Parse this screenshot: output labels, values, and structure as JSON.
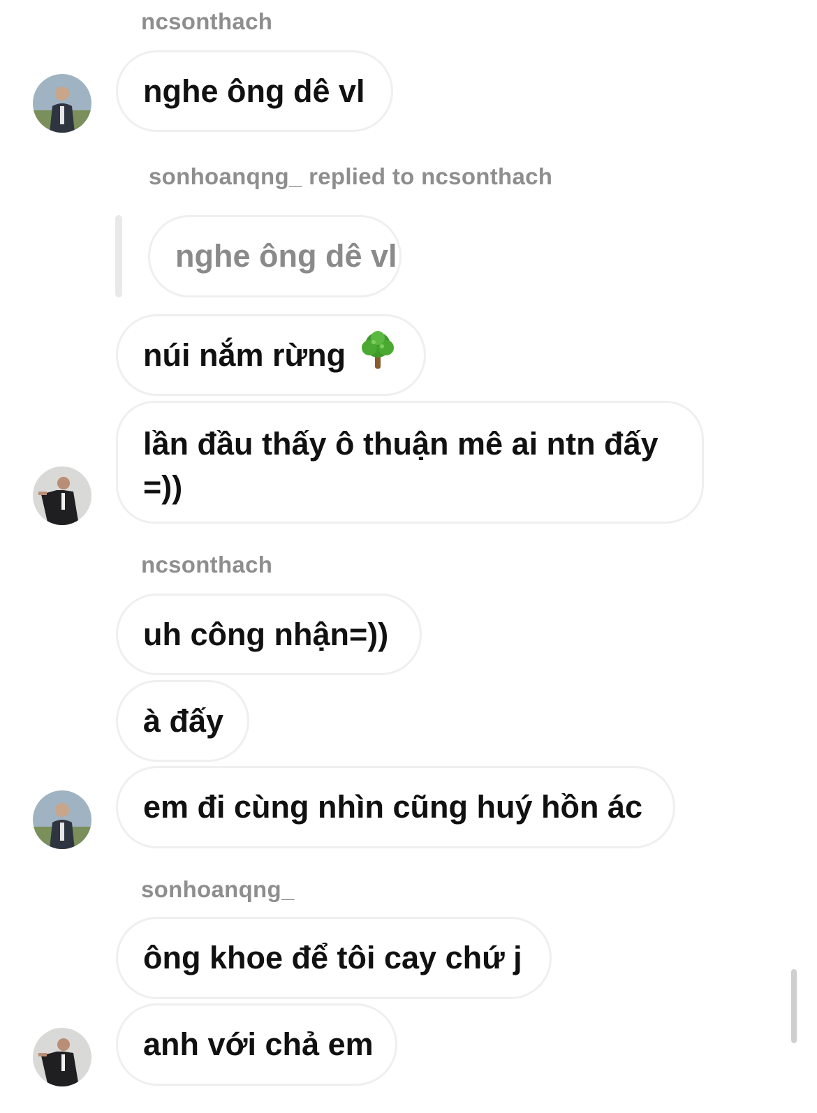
{
  "thread": {
    "senders": {
      "s1": "ncsonthach",
      "s2": "sonhoanqng_ replied to ncsonthach",
      "s3": "ncsonthach",
      "s4": "sonhoanqng_"
    },
    "messages": {
      "m1": "nghe ông dê vl",
      "quoted": "nghe ông dê vl",
      "m2": "núi nắm rừng",
      "m3": "lần đầu thấy ô thuận mê ai ntn đấy =))",
      "m4": "uh công nhận=))",
      "m5": "à đấy",
      "m6": "em đi cùng nhìn cũng huý hồn ác",
      "m7": "ông khoe để tôi cay chứ j",
      "m8": "anh với chả em"
    }
  },
  "icons": {
    "tree_emoji": "deciduous-tree-icon"
  },
  "colors": {
    "sender_text": "#8e8e8e",
    "bubble_border": "#efefef",
    "message_text": "#111111"
  }
}
